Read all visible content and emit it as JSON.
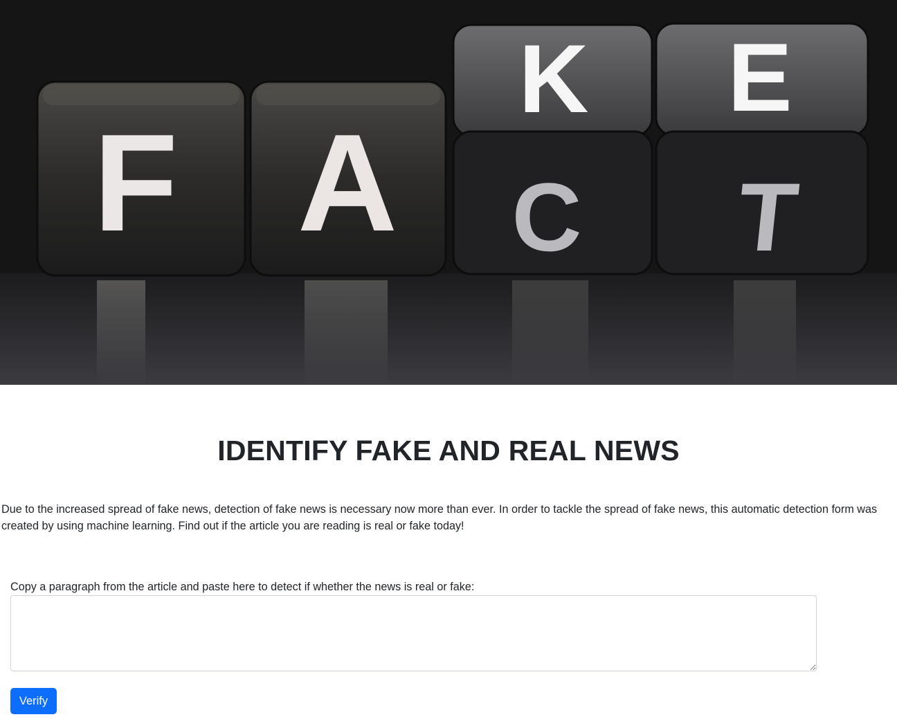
{
  "hero": {
    "letters_top": [
      "F",
      "A",
      "K",
      "E"
    ],
    "letters_bottom": [
      "C",
      "T"
    ]
  },
  "page_title": "IDENTIFY FAKE AND REAL NEWS",
  "intro_text": "Due to the increased spread of fake news, detection of fake news is necessary now more than ever. In order to tackle the spread of fake news, this automatic detection form was created by using machine learning. Find out if the article you are reading is real or fake today!",
  "form": {
    "label": "Copy a paragraph from the article and paste here to detect if whether the news is real or fake:",
    "textarea_value": "",
    "button_label": "Verify"
  },
  "colors": {
    "primary": "#0d6efd",
    "text": "#212529"
  }
}
